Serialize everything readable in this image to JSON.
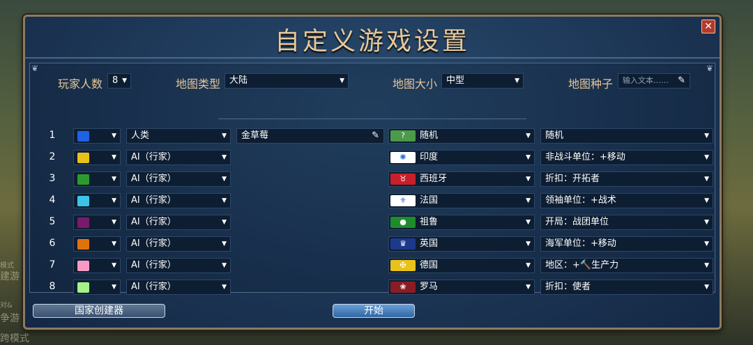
{
  "background_fragments": [
    "模式",
    "建游",
    "对&",
    "争游",
    "跨模式"
  ],
  "title": "自定义游戏设置",
  "close_glyph": "✕",
  "settings": {
    "players_label": "玩家人数",
    "players_value": "8",
    "map_type_label": "地图类型",
    "map_type_value": "大陆",
    "map_size_label": "地图大小",
    "map_size_value": "中型",
    "map_seed_label": "地图种子",
    "map_seed_placeholder": "输入文本……"
  },
  "players": [
    {
      "num": "1",
      "color": "#1e63e6",
      "type": "人类",
      "name": "金草莓",
      "civ": "随机",
      "flag_glyph": "?",
      "flag_bg": "#4d9a4a",
      "bonus": "随机"
    },
    {
      "num": "2",
      "color": "#e8c21a",
      "type": "AI（行家）",
      "name": "",
      "civ": "印度",
      "flag_glyph": "✺",
      "flag_bg": "#ffffff",
      "bonus": "非战斗单位：+移动"
    },
    {
      "num": "3",
      "color": "#2c9a2f",
      "type": "AI（行家）",
      "name": "",
      "civ": "西班牙",
      "flag_glyph": "♉",
      "flag_bg": "#c8202a",
      "bonus": "折扣：开拓者"
    },
    {
      "num": "4",
      "color": "#3cc3e8",
      "type": "AI（行家）",
      "name": "",
      "civ": "法国",
      "flag_glyph": "⚜",
      "flag_bg": "#ffffff",
      "bonus": "领袖单位：+战术"
    },
    {
      "num": "5",
      "color": "#7a1a6d",
      "type": "AI（行家）",
      "name": "",
      "civ": "祖鲁",
      "flag_glyph": "●",
      "flag_bg": "#1f8c2c",
      "bonus": "开局：战团单位"
    },
    {
      "num": "6",
      "color": "#e0720e",
      "type": "AI（行家）",
      "name": "",
      "civ": "英国",
      "flag_glyph": "♛",
      "flag_bg": "#1c3a8c",
      "bonus": "海军单位：+移动"
    },
    {
      "num": "7",
      "color": "#f59ac6",
      "type": "AI（行家）",
      "name": "",
      "civ": "德国",
      "flag_glyph": "✠",
      "flag_bg": "#e8c21a",
      "bonus": "地区：+🔨生产力"
    },
    {
      "num": "8",
      "color": "#a6f08a",
      "type": "AI（行家）",
      "name": "",
      "civ": "罗马",
      "flag_glyph": "❀",
      "flag_bg": "#8a1c26",
      "bonus": "折扣：使者"
    }
  ],
  "buttons": {
    "nation_creator": "国家创建器",
    "start": "开始"
  },
  "colors": {
    "panel_bg": "#1c3554",
    "title_gold": "#e7c89a",
    "label_gold": "#e6c596",
    "frame": "#8a7c63"
  }
}
